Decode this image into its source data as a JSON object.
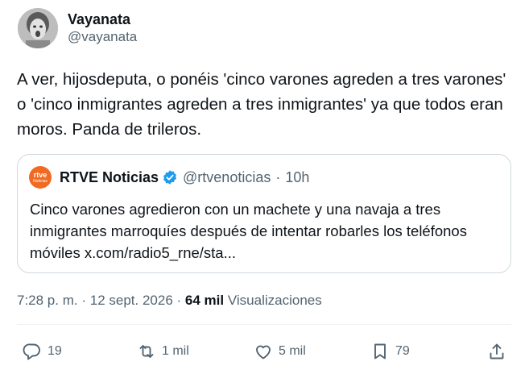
{
  "author": {
    "display_name": "Vayanata",
    "handle": "@vayanata"
  },
  "tweet": {
    "text": "A ver, hijosdeputa, o ponéis 'cinco varones agreden a tres varones' o 'cinco inmigrantes agreden a tres inmigrantes' ya que todos eran moros. Panda de trileros."
  },
  "quoted": {
    "logo_line1": "rtve",
    "logo_line2": "Noticias",
    "name": "RTVE Noticias",
    "handle": "@rtvenoticias",
    "separator": "·",
    "time": "10h",
    "text": "Cinco varones agredieron con un machete y una navaja a tres inmigrantes marroquíes después de intentar robarles los teléfonos móviles x.com/radio5_rne/sta..."
  },
  "meta": {
    "time": "7:28 p. m.",
    "sep1": "·",
    "date": "12 sept. 2026",
    "sep2": "·",
    "views_count": "64 mil",
    "views_label": "Visualizaciones"
  },
  "actions": {
    "reply_count": "19",
    "retweet_count": "1 mil",
    "like_count": "5 mil",
    "bookmark_count": "79"
  },
  "colors": {
    "text": "#0f1419",
    "secondary": "#536471",
    "border": "#cfd9de",
    "verified": "#1d9bf0",
    "rtve_orange": "#f06a22"
  }
}
